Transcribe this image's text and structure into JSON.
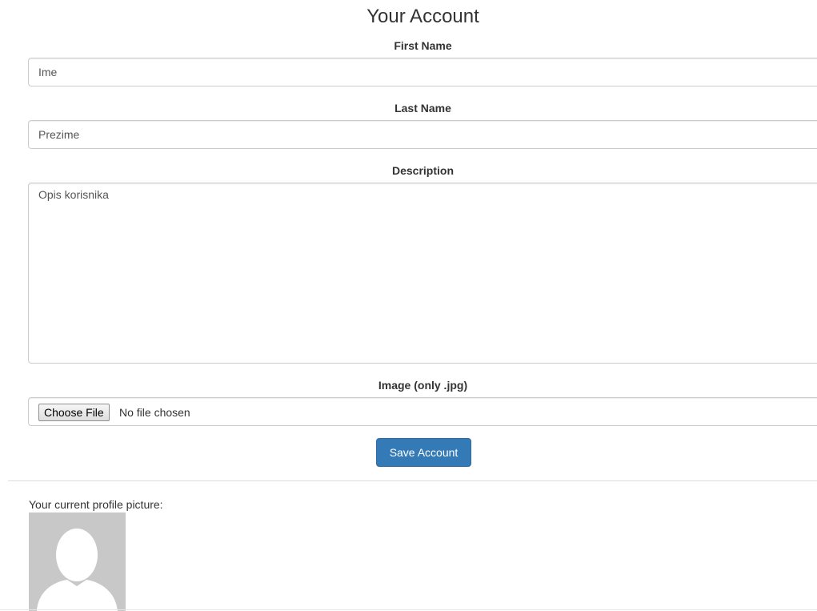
{
  "page": {
    "title": "Your Account"
  },
  "form": {
    "first_name": {
      "label": "First Name",
      "value": "Ime"
    },
    "last_name": {
      "label": "Last Name",
      "value": "Prezime"
    },
    "description": {
      "label": "Description",
      "value": "Opis korisnika"
    },
    "image": {
      "label": "Image (only .jpg)",
      "button_label": "Choose File",
      "status": "No file chosen"
    },
    "save_label": "Save Account"
  },
  "profile": {
    "caption": "Your current profile picture:",
    "avatar_icon": "default-user-silhouette-icon"
  },
  "colors": {
    "primary": "#337ab7",
    "avatar_bg": "#c8c8c8",
    "border": "#cccccc"
  }
}
